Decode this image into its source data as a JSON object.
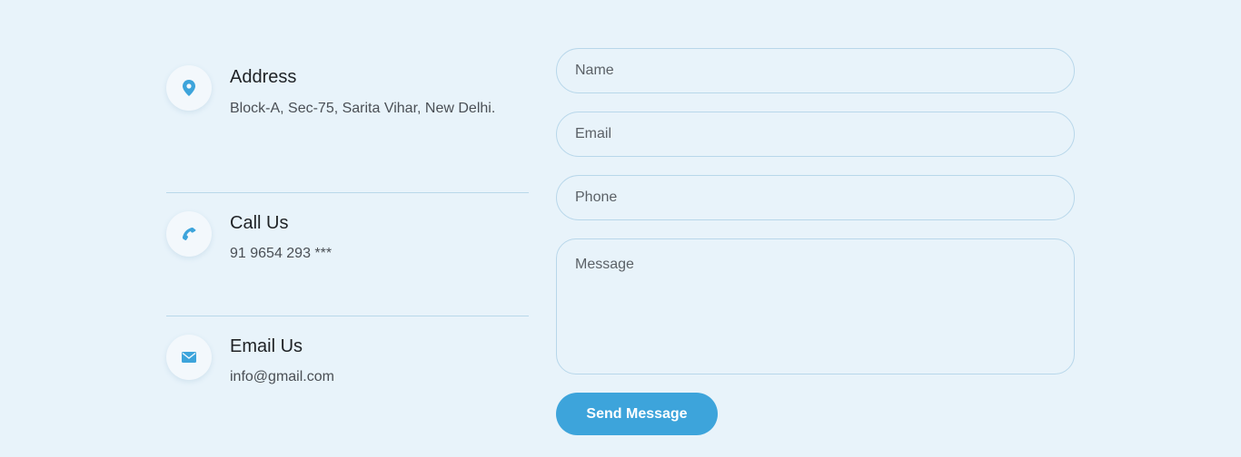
{
  "colors": {
    "background": "#e8f3fa",
    "accent": "#3da4db",
    "divider": "#b9d8ea"
  },
  "contact_info": {
    "address": {
      "icon": "map-pin-icon",
      "title": "Address",
      "text": "Block-A, Sec-75, Sarita Vihar, New Delhi."
    },
    "call": {
      "icon": "phone-icon",
      "title": "Call Us",
      "text": "91 9654 293 ***"
    },
    "email": {
      "icon": "envelope-icon",
      "title": "Email Us",
      "text": "info@gmail.com"
    }
  },
  "form": {
    "name_placeholder": "Name",
    "email_placeholder": "Email",
    "phone_placeholder": "Phone",
    "message_placeholder": "Message",
    "submit_label": "Send Message"
  }
}
